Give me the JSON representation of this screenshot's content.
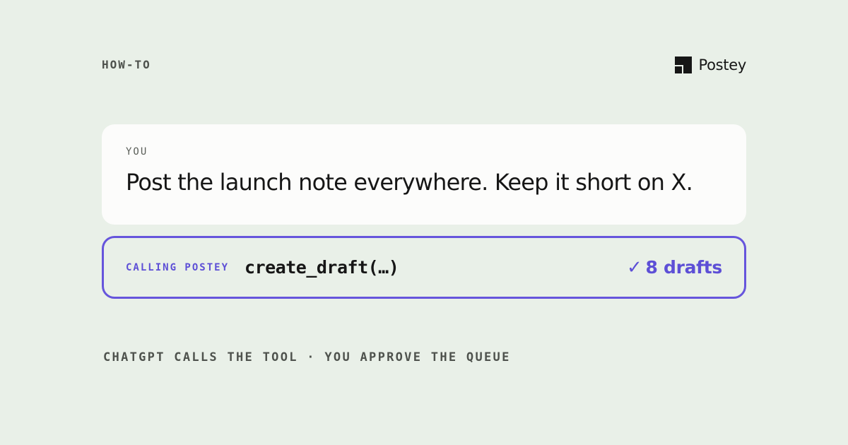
{
  "header": {
    "eyebrow": "HOW-TO",
    "brand_name": "Postey",
    "brand_icon": "postey-logo-icon"
  },
  "message": {
    "role": "YOU",
    "text": "Post the launch note everywhere. Keep it short on X."
  },
  "tool_call": {
    "label": "CALLING POSTEY",
    "call": "create_draft(…)",
    "result_icon": "check-icon",
    "result_check": "✓",
    "result_text": "8 drafts"
  },
  "footer": {
    "text": "CHATGPT CALLS THE TOOL · YOU APPROVE THE QUEUE"
  },
  "colors": {
    "background": "#e9f0e8",
    "card": "#fcfcfb",
    "accent": "#5d4fd6",
    "text": "#161616",
    "muted": "#4e524d"
  }
}
